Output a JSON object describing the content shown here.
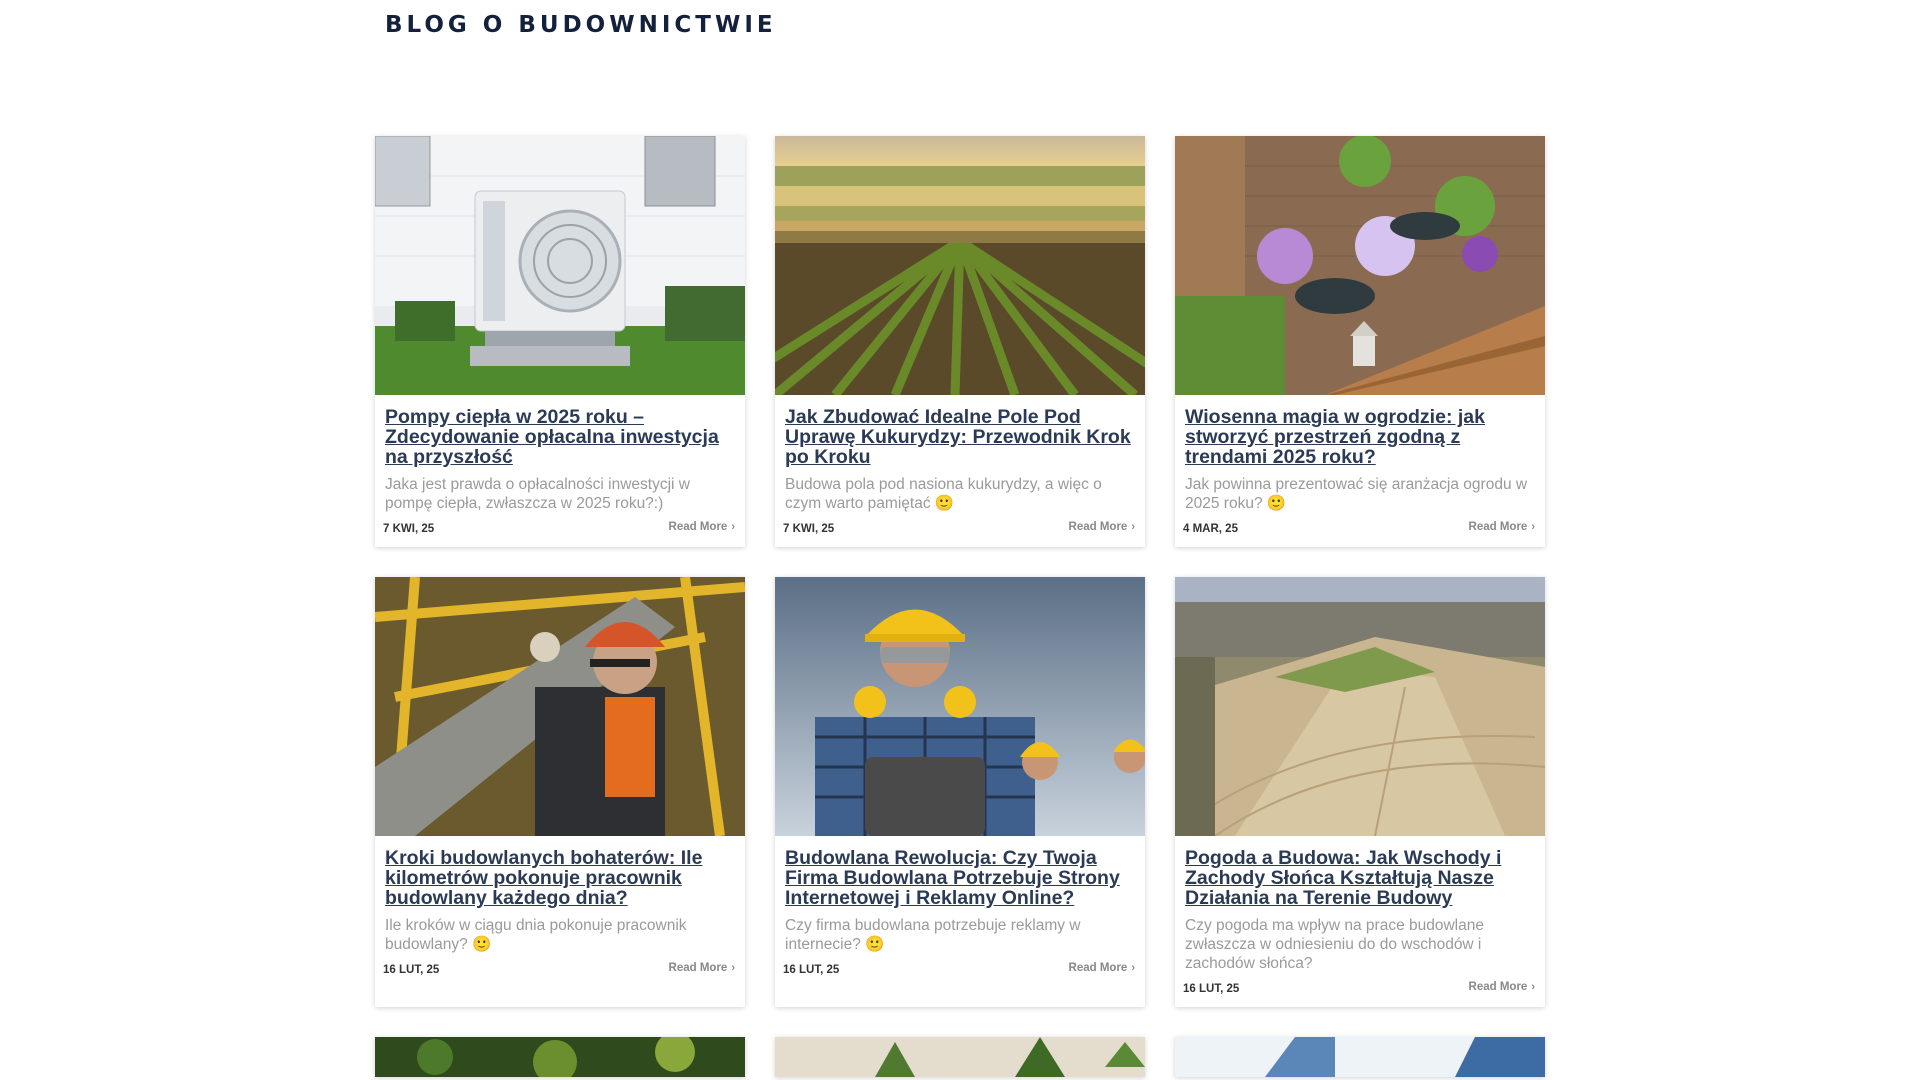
{
  "site": {
    "title": "BLOG O BUDOWNICTWIE"
  },
  "posts": [
    {
      "title": "Pompy ciepła w 2025 roku – Zdecydowanie opłacalna inwestycja na przyszłość",
      "excerpt": "Jaka jest prawda o opłacalności inwestycji w pompę ciepła, zwłaszcza w 2025 roku?:)",
      "date": "7 KWI, 25",
      "read_more": "Read More",
      "image": "heat-pump-outdoor-unit"
    },
    {
      "title": "Jak Zbudować Idealne Pole Pod Uprawę Kukurydzy: Przewodnik Krok po Kroku",
      "excerpt": "Budowa pola pod nasiona kukurydzy, a więc o czym warto pamiętać 🙂",
      "date": "7 KWI, 25",
      "read_more": "Read More",
      "image": "plowed-field-rows"
    },
    {
      "title": "Wiosenna magia w ogrodzie: jak stworzyć przestrzeń zgodną z trendami 2025 roku?",
      "excerpt": "Jak powinna prezentować się aranżacja ogrodu w 2025 roku? 🙂",
      "date": "4 MAR, 25",
      "read_more": "Read More",
      "image": "garden-flower-pots"
    },
    {
      "title": "Kroki budowlanych bohaterów: Ile kilometrów pokonuje pracownik budowlany każdego dnia?",
      "excerpt": "Ile kroków w ciągu dnia pokonuje pracownik budowlany? 🙂",
      "date": "16 LUT, 25",
      "read_more": "Read More",
      "image": "construction-worker-carrying-pipe"
    },
    {
      "title": "Budowlana Rewolucja: Czy Twoja Firma Budowlana Potrzebuje Strony Internetowej i Reklamy Online?",
      "excerpt": "Czy firma budowlana potrzebuje reklamy w internecie? 🙂",
      "date": "16 LUT, 25",
      "read_more": "Read More",
      "image": "engineer-with-tablet"
    },
    {
      "title": "Pogoda a Budowa: Jak Wschody i Zachody Słońca Kształtują Nasze Działania na Terenie Budowy",
      "excerpt": "Czy pogoda ma wpływ na prace budowlane zwłaszcza w odniesieniu do do wschodów i zachodów słońca?",
      "date": "16 LUT, 25",
      "read_more": "Read More",
      "image": "aerial-construction-site"
    }
  ],
  "partial_posts": [
    {
      "image": "garden-greenery"
    },
    {
      "image": "hemp-leaves-on-wood"
    },
    {
      "image": "glass-skyscrapers"
    }
  ],
  "colors": {
    "title": "#14213d",
    "post_title": "#2b3a55",
    "excerpt": "#9a9a9a"
  }
}
